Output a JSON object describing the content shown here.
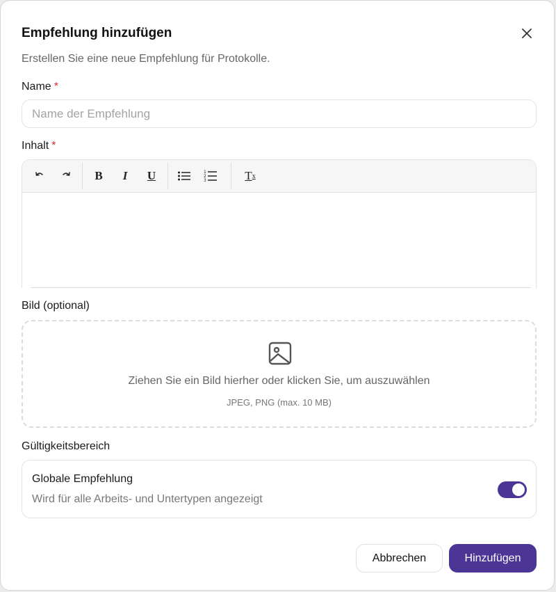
{
  "dialog": {
    "title": "Empfehlung hinzufügen",
    "subtitle": "Erstellen Sie eine neue Empfehlung für Protokolle.",
    "close_icon": "close-icon"
  },
  "name_field": {
    "label": "Name",
    "required_marker": "*",
    "placeholder": "Name der Empfehlung",
    "value": ""
  },
  "content_field": {
    "label": "Inhalt",
    "required_marker": "*",
    "toolbar": {
      "undo_icon": "undo-icon",
      "redo_icon": "redo-icon",
      "bold": "B",
      "italic": "I",
      "underline": "U",
      "bullet_list_icon": "bullet-list-icon",
      "numbered_list_icon": "numbered-list-icon",
      "clear_format": "T",
      "clear_format_sub": "x"
    },
    "value": ""
  },
  "image_field": {
    "label": "Bild (optional)",
    "drop_text": "Ziehen Sie ein Bild hierher oder klicken Sie, um auszuwählen",
    "hint": "JPEG, PNG (max. 10 MB)",
    "icon": "image-icon"
  },
  "scope": {
    "label": "Gültigkeitsbereich",
    "title": "Globale Empfehlung",
    "description": "Wird für alle Arbeits- und Untertypen angezeigt",
    "toggle_on": true
  },
  "actions": {
    "cancel": "Abbrechen",
    "submit": "Hinzufügen"
  },
  "colors": {
    "accent": "#4b3695",
    "required": "#d92d2d"
  }
}
